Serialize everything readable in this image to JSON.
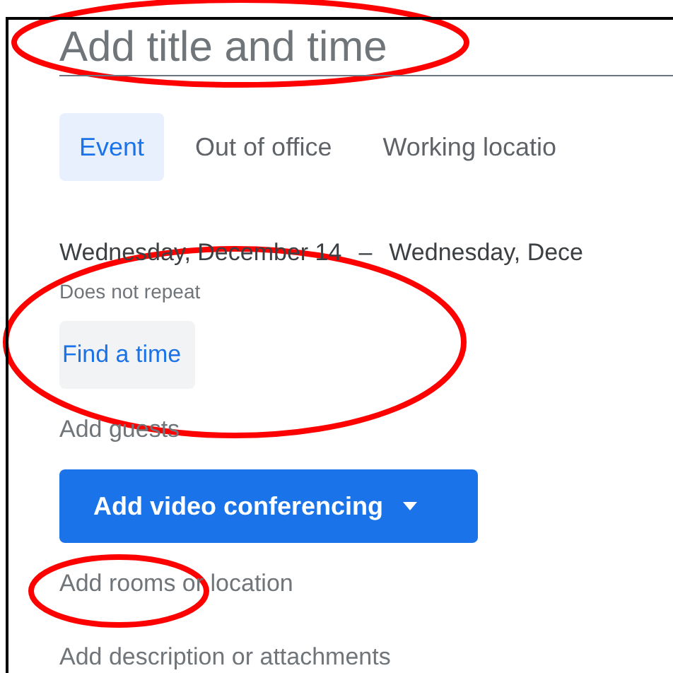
{
  "title_field": {
    "placeholder": "Add title and time"
  },
  "tabs": [
    {
      "label": "Event",
      "selected": true
    },
    {
      "label": "Out of office",
      "selected": false
    },
    {
      "label": "Working locatio",
      "selected": false
    }
  ],
  "dates": {
    "start": "Wednesday, December 14",
    "separator": "–",
    "end": "Wednesday, Dece",
    "repeat": "Does not repeat"
  },
  "find_time_button": "Find a time",
  "guests": "Add guests",
  "video_button": {
    "label": "Add video conferencing"
  },
  "location": "Add rooms or location",
  "description": "Add description or attachments",
  "annotations": [
    {
      "kind": "ellipse"
    },
    {
      "kind": "ellipse"
    },
    {
      "kind": "ellipse"
    }
  ]
}
